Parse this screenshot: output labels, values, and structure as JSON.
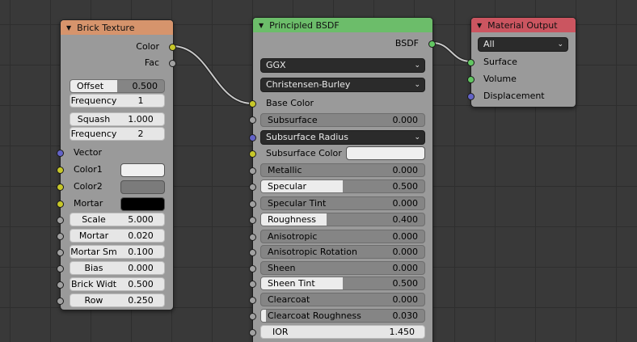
{
  "brick_texture": {
    "title": "Brick Texture",
    "outputs": [
      "Color",
      "Fac"
    ],
    "offset": {
      "label": "Offset",
      "value": "0.500",
      "fraction": 0.5
    },
    "frequency1": {
      "label": "Frequency",
      "value": "1"
    },
    "squash": {
      "label": "Squash",
      "value": "1.000"
    },
    "frequency2": {
      "label": "Frequency",
      "value": "2"
    },
    "vector_label": "Vector",
    "color1": {
      "label": "Color1",
      "swatch": "#f0f0f0"
    },
    "color2": {
      "label": "Color2",
      "swatch": "#7b7b7b"
    },
    "mortar": {
      "label": "Mortar",
      "swatch": "#000000"
    },
    "scale": {
      "label": "Scale",
      "value": "5.000"
    },
    "mortar_size": {
      "label": "Mortar Size",
      "value": "0.020"
    },
    "mortar_smooth": {
      "label": "Mortar Sm",
      "value": "0.100"
    },
    "bias": {
      "label": "Bias",
      "value": "0.000"
    },
    "brick_width": {
      "label": "Brick Widt",
      "value": "0.500"
    },
    "row_height": {
      "label": "Row Heigh",
      "value": "0.250"
    }
  },
  "principled": {
    "title": "Principled BSDF",
    "output": "BSDF",
    "distribution": "GGX",
    "subsurface_method": "Christensen-Burley",
    "base_color": "Base Color",
    "subsurface": {
      "label": "Subsurface",
      "value": "0.000"
    },
    "subsurface_radius": "Subsurface Radius",
    "subsurface_color": {
      "label": "Subsurface Color",
      "swatch": "#efefef"
    },
    "metallic": {
      "label": "Metallic",
      "value": "0.000"
    },
    "specular": {
      "label": "Specular",
      "value": "0.500",
      "fraction": 0.5
    },
    "specular_tint": {
      "label": "Specular Tint",
      "value": "0.000"
    },
    "roughness": {
      "label": "Roughness",
      "value": "0.400",
      "fraction": 0.4
    },
    "anisotropic": {
      "label": "Anisotropic",
      "value": "0.000"
    },
    "anisotropic_rotation": {
      "label": "Anisotropic Rotation",
      "value": "0.000"
    },
    "sheen": {
      "label": "Sheen",
      "value": "0.000"
    },
    "sheen_tint": {
      "label": "Sheen Tint",
      "value": "0.500",
      "fraction": 0.5
    },
    "clearcoat": {
      "label": "Clearcoat",
      "value": "0.000"
    },
    "clearcoat_roughness": {
      "label": "Clearcoat Roughness",
      "value": "0.030",
      "fraction": 0.03
    },
    "ior": {
      "label": "IOR",
      "value": "1.450"
    }
  },
  "material_output": {
    "title": "Material Output",
    "target": "All",
    "inputs": [
      "Surface",
      "Volume",
      "Displacement"
    ]
  },
  "colors": {
    "brick_header": "#d6946c",
    "principled_header": "#6cbd6a",
    "output_header": "#cb5560",
    "color_socket": "#c7c729",
    "float_socket": "#a1a1a1",
    "vector_socket": "#6363c7",
    "shader_socket": "#62c762"
  }
}
